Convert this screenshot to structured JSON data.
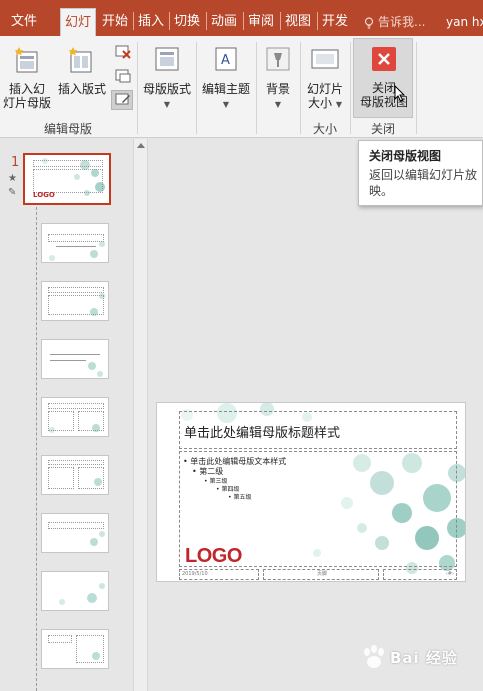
{
  "tabs": [
    {
      "label": "文件",
      "active": false
    },
    {
      "label": "幻灯",
      "active": true
    },
    {
      "label": "开始",
      "active": false
    },
    {
      "label": "插入",
      "active": false
    },
    {
      "label": "切换",
      "active": false
    },
    {
      "label": "动画",
      "active": false
    },
    {
      "label": "审阅",
      "active": false
    },
    {
      "label": "视图",
      "active": false
    },
    {
      "label": "开发",
      "active": false
    }
  ],
  "tell_me": "告诉我...",
  "user": "yan hx",
  "ribbon": {
    "insert_master_line1": "插入幻",
    "insert_master_line2": "灯片母版",
    "insert_layout": "插入版式",
    "group_edit_master": "编辑母版",
    "master_layout": "母版版式",
    "edit_theme": "编辑主题",
    "background": "背景",
    "slide_size_line1": "幻灯片",
    "slide_size_line2": "大小",
    "group_size": "大小",
    "close_line1": "关闭",
    "close_line2": "母版视图",
    "group_close": "关闭"
  },
  "tooltip": {
    "title": "关闭母版视图",
    "description": "返回以编辑幻灯片放映。"
  },
  "thumbnails": {
    "slide_number": "1",
    "logo_text": "LOGO"
  },
  "slide": {
    "title": "单击此处编辑母版标题样式",
    "level1": "• 单击此处编辑母版文本样式",
    "level2": "• 第二级",
    "level3": "• 第三级",
    "level4": "• 第四级",
    "level5": "• 第五级",
    "logo": "LOGO",
    "footer_date": "2019/5/10",
    "footer_text": "页脚",
    "footer_num": "‹#›"
  },
  "watermark": "Bai 经验",
  "colors": {
    "accent": "#b7472a",
    "logo_red": "#c0262a",
    "close_icon_red": "#e0473c"
  }
}
